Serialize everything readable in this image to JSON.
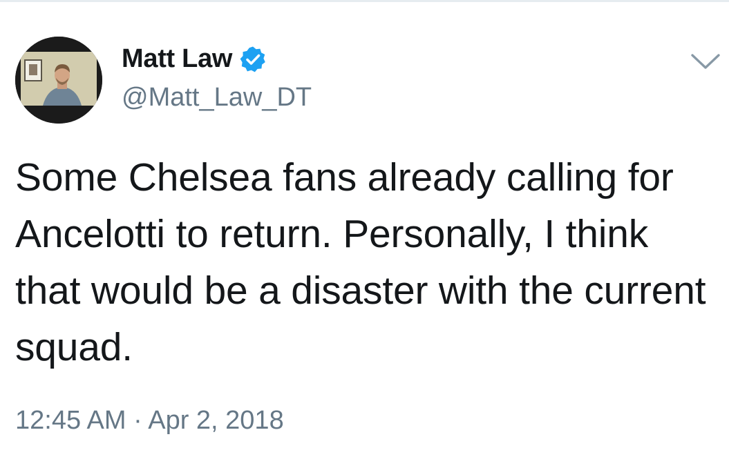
{
  "tweet": {
    "author": {
      "display_name": "Matt Law",
      "handle": "@Matt_Law_DT",
      "verified": true,
      "avatar_icon": "avatar-photo"
    },
    "text": "Some Chelsea fans already calling for Ancelotti to return. Personally, I think that would be a disaster with the current squad.",
    "timestamp": "12:45 AM · Apr 2, 2018",
    "menu_icon": "chevron-down-icon"
  },
  "colors": {
    "text": "#14171a",
    "secondary_text": "#657786",
    "verified_badge": "#1da1f2",
    "chevron": "#8899a6"
  }
}
